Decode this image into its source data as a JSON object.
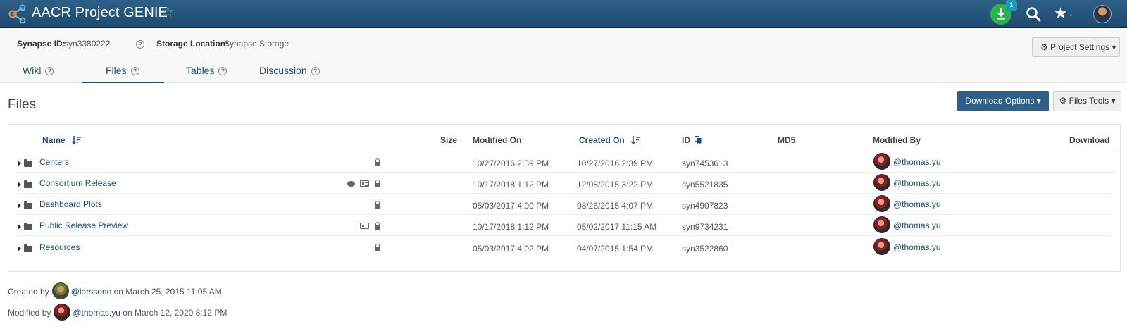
{
  "header": {
    "title": "AACR Project GENIE",
    "download_badge": "1"
  },
  "info": {
    "synapse_id_label": "Synapse ID:",
    "synapse_id": "syn3380222",
    "storage_label": "Storage Location:",
    "storage_value": "Synapse Storage",
    "project_settings": "Project Settings"
  },
  "tabs": [
    {
      "label": "Wiki"
    },
    {
      "label": "Files"
    },
    {
      "label": "Tables"
    },
    {
      "label": "Discussion"
    }
  ],
  "files": {
    "heading": "Files",
    "download_options": "Download Options",
    "files_tools": "Files Tools",
    "columns": {
      "name": "Name",
      "size": "Size",
      "modified_on": "Modified On",
      "created_on": "Created On",
      "id": "ID",
      "md5": "MD5",
      "modified_by": "Modified By",
      "download": "Download"
    },
    "rows": [
      {
        "name": "Centers",
        "modified_on": "10/27/2016 2:39 PM",
        "created_on": "10/27/2016 2:39 PM",
        "id": "syn7453613",
        "modified_by": "@thomas.yu"
      },
      {
        "name": "Consortium Release",
        "modified_on": "10/17/2018 1:12 PM",
        "created_on": "12/08/2015 3:22 PM",
        "id": "syn5521835",
        "modified_by": "@thomas.yu"
      },
      {
        "name": "Dashboard Plots",
        "modified_on": "05/03/2017 4:00 PM",
        "created_on": "08/26/2015 4:07 PM",
        "id": "syn4907823",
        "modified_by": "@thomas.yu"
      },
      {
        "name": "Public Release Preview",
        "modified_on": "10/17/2018 1:12 PM",
        "created_on": "05/02/2017 11:15 AM",
        "id": "syn9734231",
        "modified_by": "@thomas.yu"
      },
      {
        "name": "Resources",
        "modified_on": "05/03/2017 4:02 PM",
        "created_on": "04/07/2015 1:54 PM",
        "id": "syn3522860",
        "modified_by": "@thomas.yu"
      }
    ]
  },
  "footer": {
    "created_prefix": "Created by",
    "created_user": "@larssono",
    "created_date": "on March 25, 2015 11:05 AM",
    "modified_prefix": "Modified by",
    "modified_user": "@thomas.yu",
    "modified_date": "on March 12, 2020 8:12 PM"
  }
}
